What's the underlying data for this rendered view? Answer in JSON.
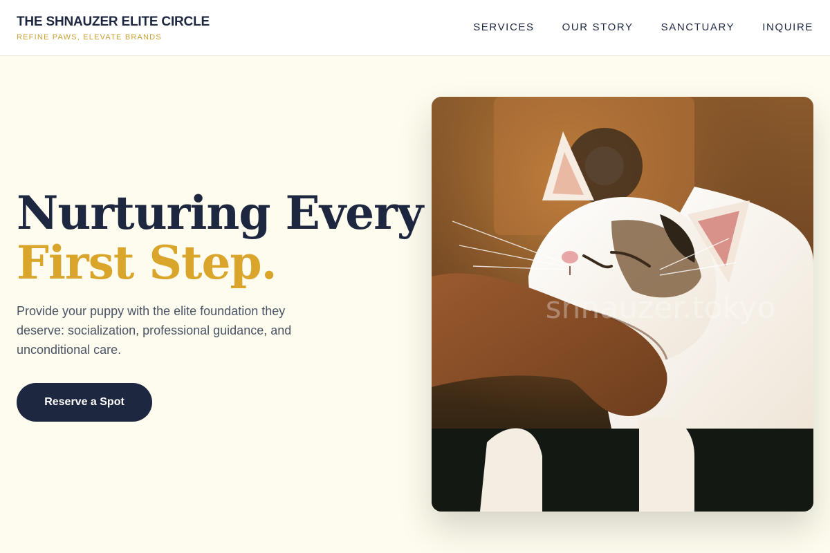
{
  "header": {
    "title": "THE SHNAUZER ELITE CIRCLE",
    "tagline": "REFINE PAWS, ELEVATE BRANDS",
    "nav": [
      {
        "label": "SERVICES"
      },
      {
        "label": "OUR STORY"
      },
      {
        "label": "SANCTUARY"
      },
      {
        "label": "INQUIRE"
      }
    ]
  },
  "hero": {
    "headline_line1": "Nurturing Every",
    "headline_line2": "First Step.",
    "description": "Provide your puppy with the elite foundation they deserve: socialization, professional guidance, and unconditional care.",
    "cta_label": "Reserve a Spot",
    "image_watermark": "shnauzer.tokyo"
  },
  "colors": {
    "navy": "#1d2740",
    "gold": "#d9a52b",
    "background": "#fdfcee"
  }
}
